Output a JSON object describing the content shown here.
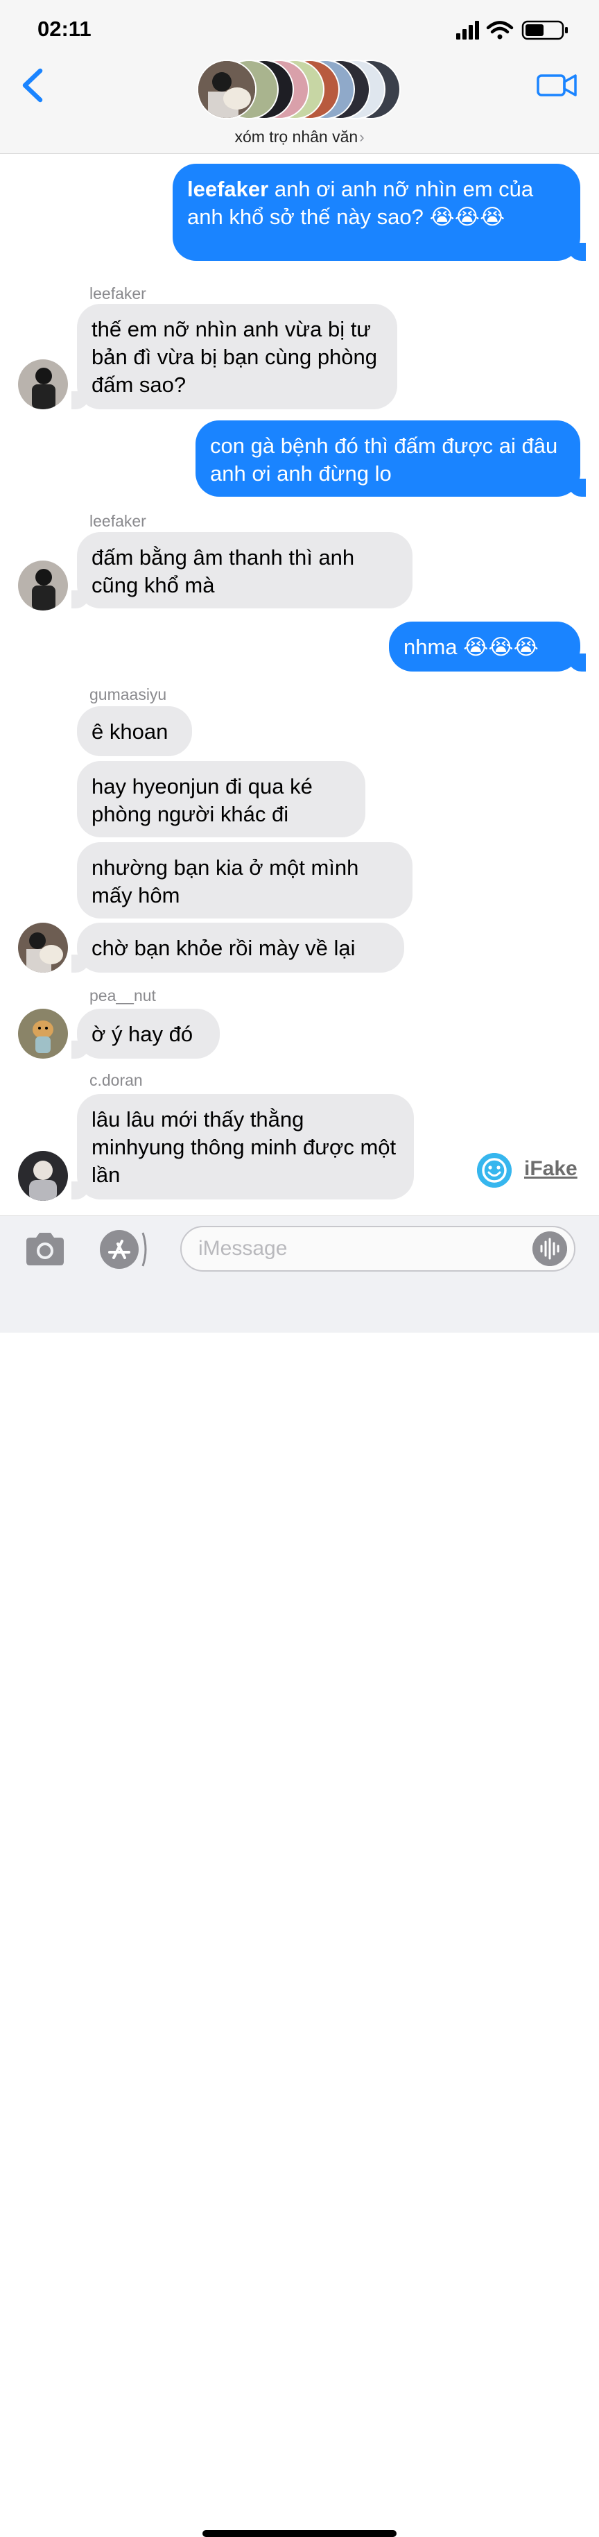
{
  "status_bar": {
    "time": "02:11"
  },
  "header": {
    "group_name": "xóm trọ nhân văn",
    "chevron": "›"
  },
  "messages": [
    {
      "mention": "leefaker",
      "text": " anh ơi anh nỡ nhìn em của anh khổ sở thế này sao? 😭😭😭"
    },
    {
      "sender": "leefaker",
      "text": "thế em nỡ nhìn anh vừa bị tư bản đì vừa bị bạn cùng phòng đấm sao?"
    },
    {
      "text": "con gà bệnh đó thì đấm được ai đâu anh ơi anh đừng lo"
    },
    {
      "sender": "leefaker",
      "text": "đấm bằng âm thanh thì anh cũng khổ mà"
    },
    {
      "text": "nhma 😭😭😭"
    },
    {
      "sender": "gumaasiyu",
      "text": "ê khoan"
    },
    {
      "text": "hay hyeonjun đi qua ké phòng người khác đi"
    },
    {
      "text": "nhường bạn kia ở một mình mấy hôm"
    },
    {
      "text": "chờ bạn khỏe rồi mày về lại"
    },
    {
      "sender": "pea__nut",
      "text": "ờ ý hay đó"
    },
    {
      "sender": "c.doran",
      "text": "lâu lâu mới thấy thằng minhyung thông minh được một lần"
    }
  ],
  "watermark": {
    "label": "iFake",
    "icon": "smiley-icon"
  },
  "input": {
    "placeholder": "iMessage"
  },
  "colors": {
    "outgoing": "#1a84ff",
    "incoming": "#e9e9eb",
    "accent": "#1a84ff"
  }
}
